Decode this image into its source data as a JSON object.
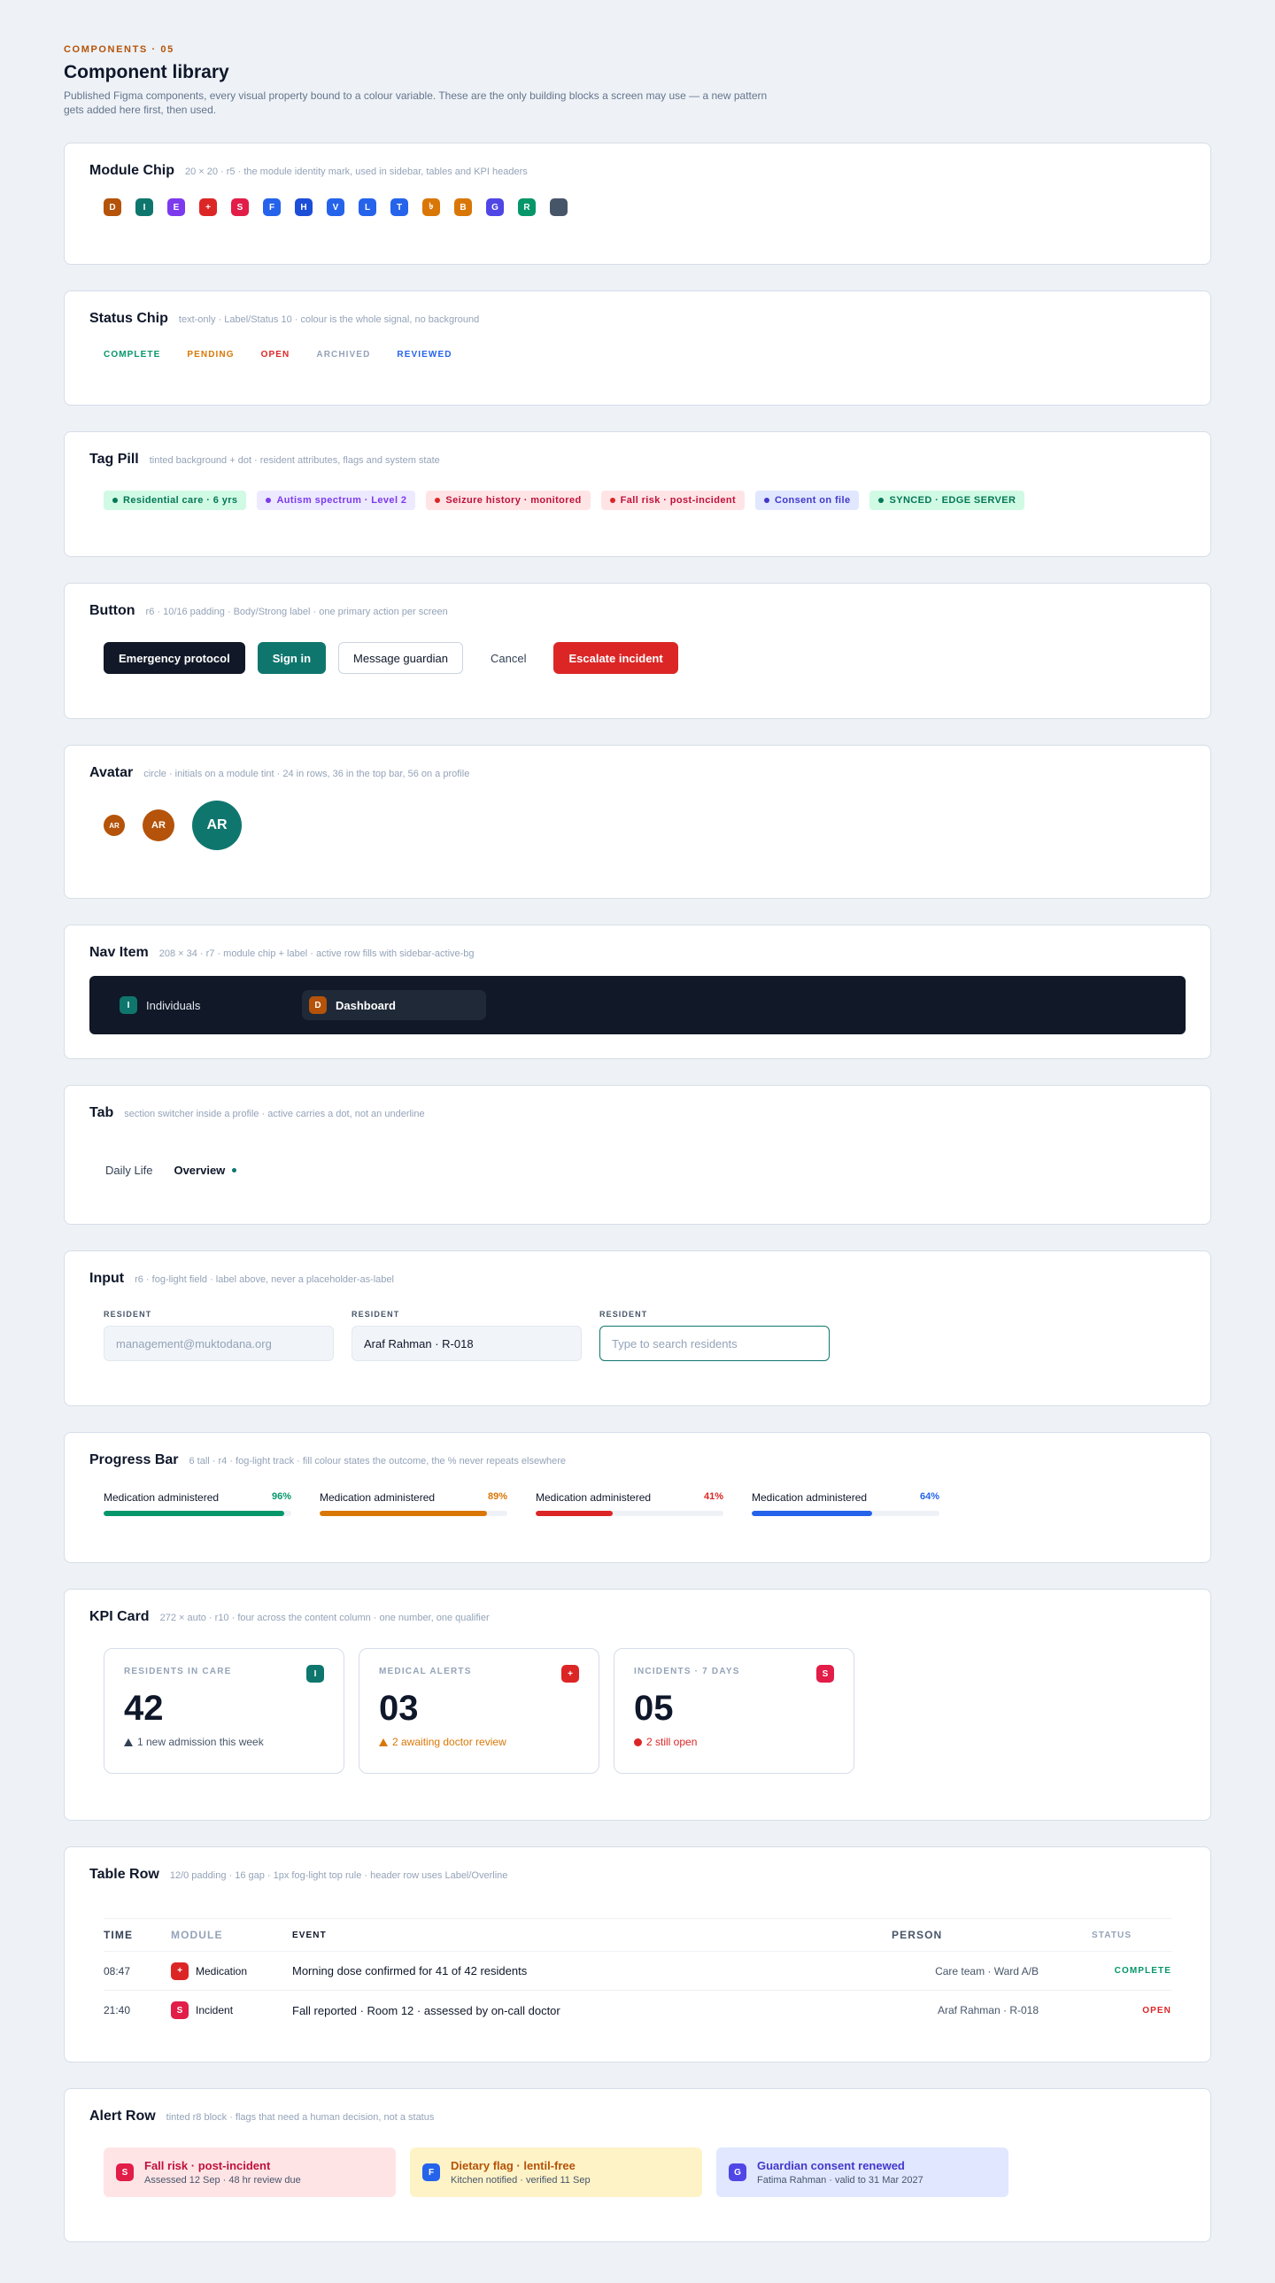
{
  "header": {
    "eyebrow": "COMPONENTS · 05",
    "title": "Component library",
    "description": "Published Figma components, every visual property bound to a colour variable. These are the only building blocks a screen may use — a new pattern gets added here first, then used."
  },
  "module_chip": {
    "title": "Module Chip",
    "meta": "20 × 20 · r5 · the module identity mark, used in sidebar, tables and KPI headers",
    "chips": [
      {
        "letter": "D",
        "color": "#b45309"
      },
      {
        "letter": "I",
        "color": "#0f766e"
      },
      {
        "letter": "E",
        "color": "#7c3aed"
      },
      {
        "letter": "+",
        "color": "#dc2626"
      },
      {
        "letter": "S",
        "color": "#e11d48"
      },
      {
        "letter": "F",
        "color": "#2563eb"
      },
      {
        "letter": "H",
        "color": "#1d4ed8"
      },
      {
        "letter": "V",
        "color": "#2563eb"
      },
      {
        "letter": "L",
        "color": "#2563eb"
      },
      {
        "letter": "T",
        "color": "#2563eb"
      },
      {
        "letter": "৳",
        "color": "#d97706"
      },
      {
        "letter": "B",
        "color": "#d97706"
      },
      {
        "letter": "G",
        "color": "#4f46e5"
      },
      {
        "letter": "R",
        "color": "#059669"
      },
      {
        "letter": "",
        "color": "#475569"
      }
    ]
  },
  "status_chip": {
    "title": "Status Chip",
    "meta": "text-only · Label/Status 10 · colour is the whole signal, no background",
    "items": [
      {
        "label": "COMPLETE",
        "color": "#059669"
      },
      {
        "label": "PENDING",
        "color": "#d97706"
      },
      {
        "label": "OPEN",
        "color": "#dc2626"
      },
      {
        "label": "ARCHIVED",
        "color": "#94a3b8"
      },
      {
        "label": "REVIEWED",
        "color": "#2563eb"
      }
    ]
  },
  "tag_pill": {
    "title": "Tag Pill",
    "meta": "tinted background + dot · resident attributes, flags and system state",
    "items": [
      {
        "label": "Residential care · 6 yrs",
        "bg": "#d1fae5",
        "fg": "#047857",
        "dot": "#047857"
      },
      {
        "label": "Autism spectrum · Level 2",
        "bg": "#ede9fe",
        "fg": "#7c3aed",
        "dot": "#7c3aed"
      },
      {
        "label": "Seizure history · monitored",
        "bg": "#ffe4e6",
        "fg": "#be123c",
        "dot": "#dc2626"
      },
      {
        "label": "Fall risk · post-incident",
        "bg": "#ffe4e6",
        "fg": "#be123c",
        "dot": "#dc2626"
      },
      {
        "label": "Consent on file",
        "bg": "#e0e7ff",
        "fg": "#4338ca",
        "dot": "#4338ca"
      },
      {
        "label": "SYNCED · EDGE SERVER",
        "bg": "#d1fae5",
        "fg": "#047857",
        "dot": "#047857"
      }
    ]
  },
  "button": {
    "title": "Button",
    "meta": "r6 · 10/16 padding · Body/Strong label · one primary action per screen",
    "emergency": "Emergency protocol",
    "signin": "Sign in",
    "message": "Message guardian",
    "cancel": "Cancel",
    "escalate": "Escalate incident"
  },
  "avatar": {
    "title": "Avatar",
    "meta": "circle · initials on a module tint · 24 in rows, 36 in the top bar, 56 on a profile",
    "initials_sm": "AR",
    "initials_md": "AR",
    "initials_lg": "AR"
  },
  "nav_item": {
    "title": "Nav Item",
    "meta": "208 × 34 · r7 · module chip + label · active row fills with sidebar-active-bg",
    "item1": {
      "letter": "I",
      "label": "Individuals"
    },
    "item2": {
      "letter": "D",
      "label": "Dashboard"
    }
  },
  "tab": {
    "title": "Tab",
    "meta": "section switcher inside a profile · active carries a dot, not an underline",
    "tab1": "Daily Life",
    "tab2": "Overview"
  },
  "input": {
    "title": "Input",
    "meta": "r6 · fog-light field · label above, never a placeholder-as-label",
    "field1": {
      "label": "RESIDENT",
      "placeholder": "management@muktodana.org"
    },
    "field2": {
      "label": "RESIDENT",
      "value": "Araf Rahman · R-018"
    },
    "field3": {
      "label": "RESIDENT",
      "placeholder": "Type to search residents"
    }
  },
  "progress": {
    "title": "Progress Bar",
    "meta": "6 tall · r4 · fog-light track · fill colour states the outcome, the % never repeats elsewhere",
    "bars": [
      {
        "label": "Medication administered",
        "pct": "96%",
        "value": 96,
        "color": "#059669"
      },
      {
        "label": "Medication administered",
        "pct": "89%",
        "value": 89,
        "color": "#d97706"
      },
      {
        "label": "Medication administered",
        "pct": "41%",
        "value": 41,
        "color": "#dc2626"
      },
      {
        "label": "Medication administered",
        "pct": "64%",
        "value": 64,
        "color": "#2563eb"
      }
    ]
  },
  "kpi": {
    "title": "KPI Card",
    "meta": "272 × auto · r10 · four across the content column · one number, one qualifier",
    "cards": [
      {
        "label": "RESIDENTS IN CARE",
        "chip": "I",
        "chip_color": "#0f766e",
        "value": "42",
        "note": "1 new admission this week",
        "note_color": "#475569",
        "marker": "tri"
      },
      {
        "label": "MEDICAL ALERTS",
        "chip": "+",
        "chip_color": "#dc2626",
        "value": "03",
        "note": "2 awaiting doctor review",
        "note_color": "#d97706",
        "marker": "tri"
      },
      {
        "label": "INCIDENTS · 7 DAYS",
        "chip": "S",
        "chip_color": "#e11d48",
        "value": "05",
        "note": "2 still open",
        "note_color": "#dc2626",
        "marker": "dot"
      }
    ]
  },
  "table": {
    "title": "Table Row",
    "meta": "12/0 padding · 16 gap · 1px fog-light top rule · header row uses Label/Overline",
    "headers": {
      "time": "TIME",
      "module": "MODULE",
      "event": "EVENT",
      "person": "PERSON",
      "status": "STATUS"
    },
    "rows": [
      {
        "time": "08:47",
        "chip": "+",
        "chip_color": "#dc2626",
        "module": "Medication",
        "event": "Morning dose confirmed for 41 of 42 residents",
        "person": "Care team · Ward A/B",
        "status": "COMPLETE",
        "status_color": "#059669"
      },
      {
        "time": "21:40",
        "chip": "S",
        "chip_color": "#e11d48",
        "module": "Incident",
        "event": "Fall reported · Room 12 · assessed by on-call doctor",
        "person": "Araf Rahman · R-018",
        "status": "OPEN",
        "status_color": "#dc2626"
      }
    ]
  },
  "alert": {
    "title": "Alert Row",
    "meta": "tinted r8 block · flags that need a human decision, not a status",
    "items": [
      {
        "chip": "S",
        "chip_color": "#e11d48",
        "title": "Fall risk · post-incident",
        "title_color": "#be123c",
        "sub": "Assessed 12 Sep · 48 hr review due",
        "bg": "#ffe4e6"
      },
      {
        "chip": "F",
        "chip_color": "#2563eb",
        "title": "Dietary flag · lentil-free",
        "title_color": "#b45309",
        "sub": "Kitchen notified · verified 11 Sep",
        "bg": "#fef3c7"
      },
      {
        "chip": "G",
        "chip_color": "#4f46e5",
        "title": "Guardian consent renewed",
        "title_color": "#4338ca",
        "sub": "Fatima Rahman · valid to 31 Mar 2027",
        "bg": "#e0e7ff"
      }
    ]
  }
}
